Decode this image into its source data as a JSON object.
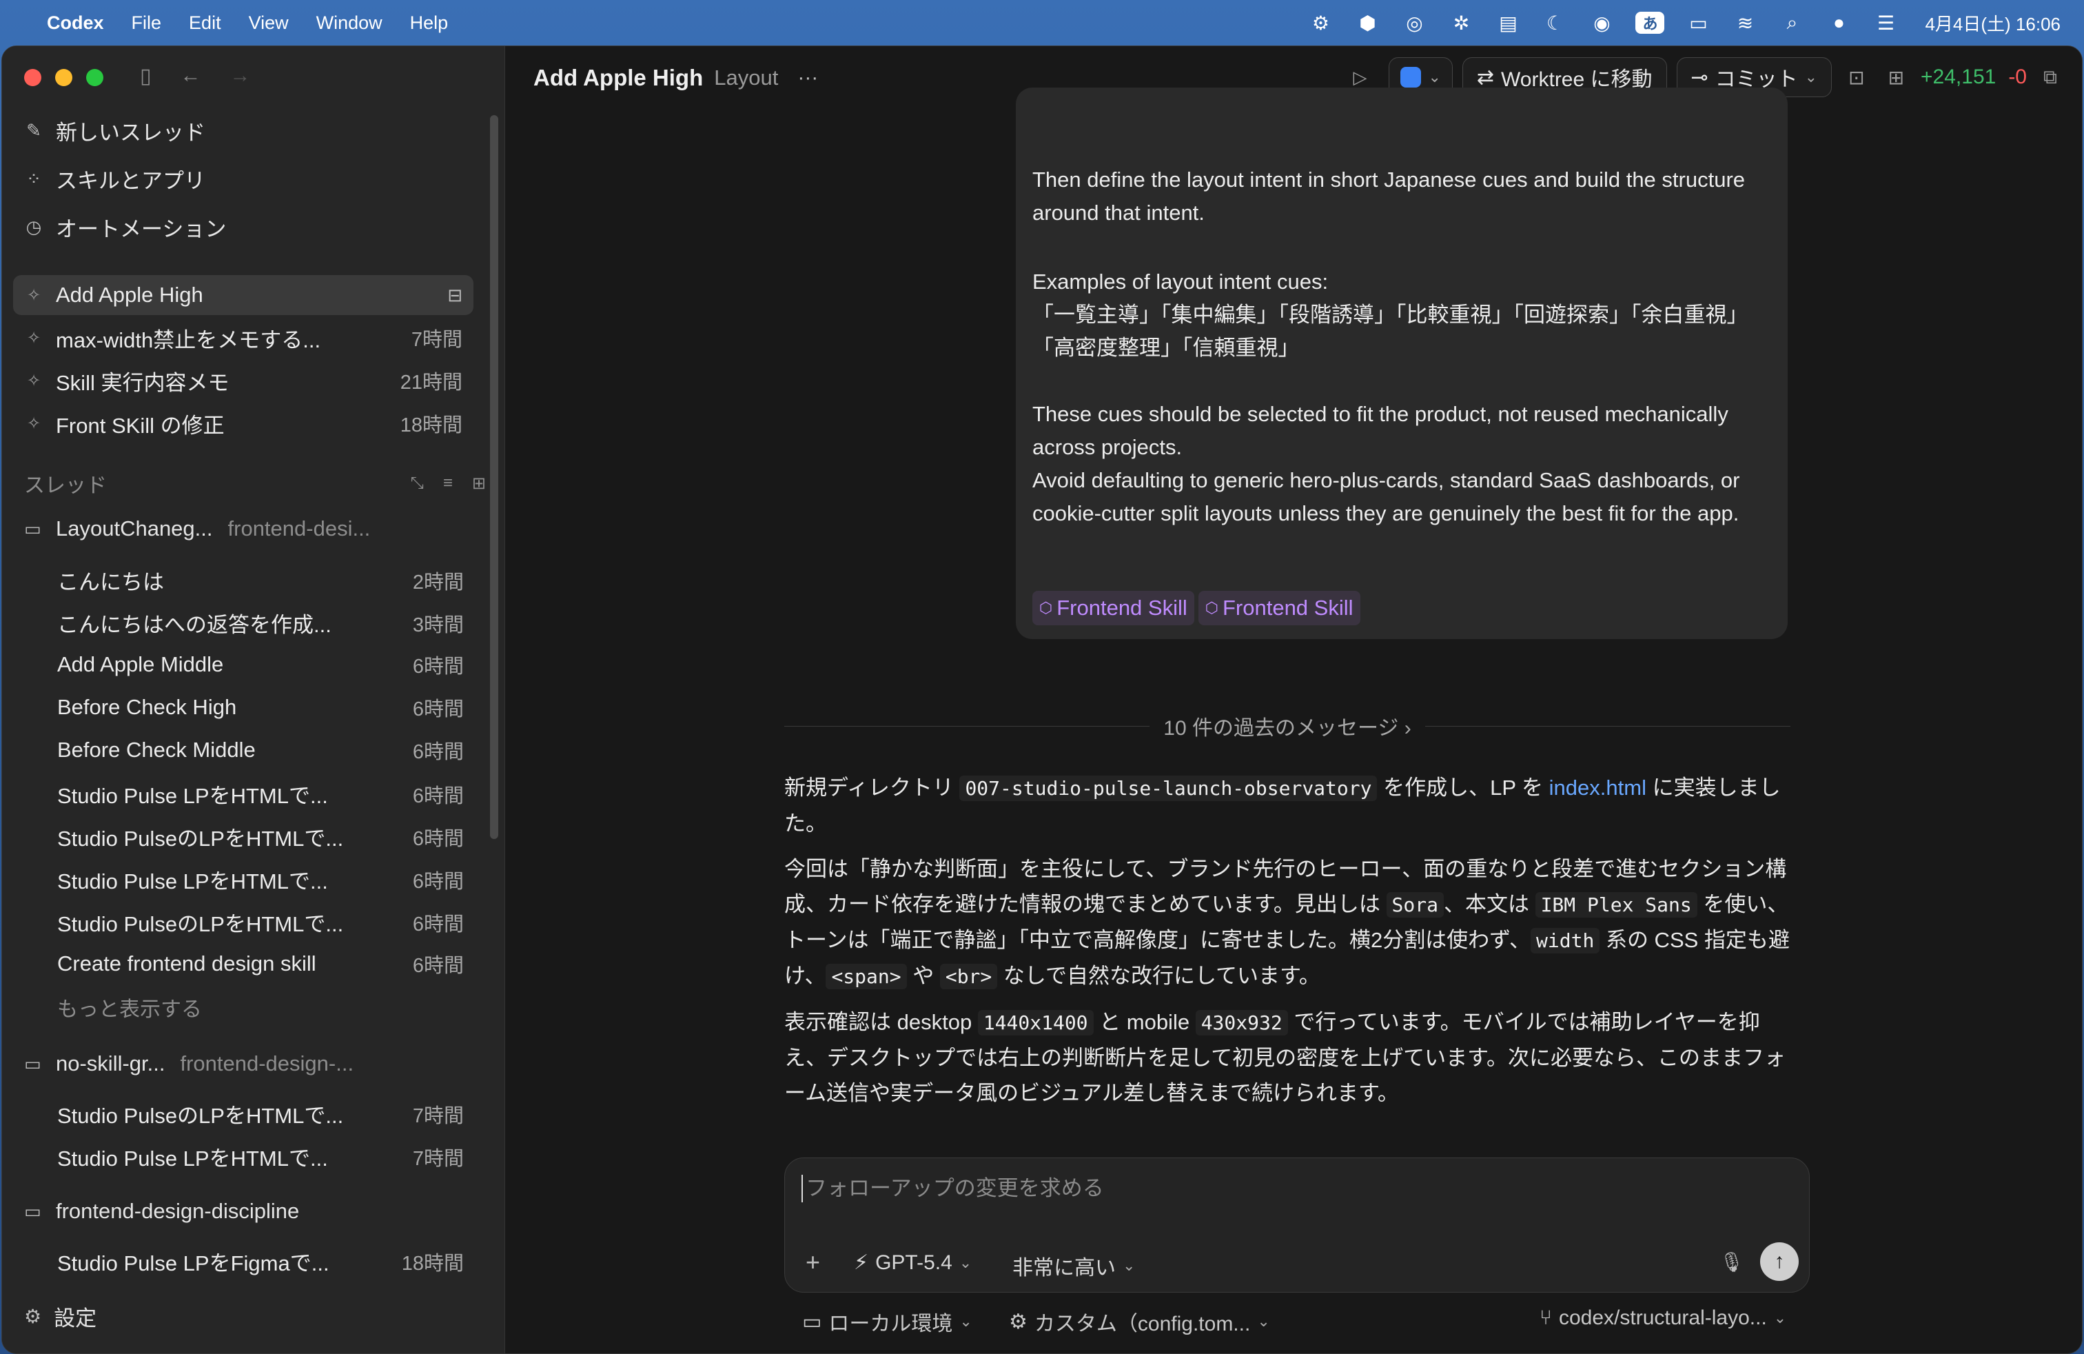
{
  "menubar": {
    "apple": "",
    "app_name": "Codex",
    "menus": [
      "File",
      "Edit",
      "View",
      "Window",
      "Help"
    ],
    "ime": "あ",
    "clock": "4月4日(土) 16:06"
  },
  "sidebar": {
    "nav": [
      {
        "label": "新しいスレッド",
        "icon": "edit-icon"
      },
      {
        "label": "スキルとアプリ",
        "icon": "grid-icon"
      },
      {
        "label": "オートメーション",
        "icon": "clock-icon"
      }
    ],
    "pinned": [
      {
        "label": "Add Apple High",
        "time": "",
        "active": true
      },
      {
        "label": "max-width禁止をメモする...",
        "time": "7時間"
      },
      {
        "label": "Skill 実行内容メモ",
        "time": "21時間"
      },
      {
        "label": "Front SKill の修正",
        "time": "18時間"
      }
    ],
    "threads_heading": "スレッド",
    "groups": [
      {
        "name": "LayoutChaneg...",
        "sub": "frontend-desi...",
        "items": [
          {
            "label": "こんにちは",
            "time": "2時間"
          },
          {
            "label": "こんにちはへの返答を作成...",
            "time": "3時間"
          },
          {
            "label": "Add Apple Middle",
            "time": "6時間"
          },
          {
            "label": "Before Check High",
            "time": "6時間"
          },
          {
            "label": "Before Check Middle",
            "time": "6時間"
          },
          {
            "label": "Studio Pulse LPをHTMLで...",
            "time": "6時間"
          },
          {
            "label": "Studio PulseのLPをHTMLで...",
            "time": "6時間"
          },
          {
            "label": "Studio Pulse LPをHTMLで...",
            "time": "6時間"
          },
          {
            "label": "Studio PulseのLPをHTMLで...",
            "time": "6時間"
          },
          {
            "label": "Create frontend design skill",
            "time": "6時間"
          }
        ],
        "more": "もっと表示する"
      },
      {
        "name": "no-skill-gr...",
        "sub": "frontend-design-...",
        "items": [
          {
            "label": "Studio PulseのLPをHTMLで...",
            "time": "7時間"
          },
          {
            "label": "Studio Pulse LPをHTMLで...",
            "time": "7時間"
          }
        ]
      },
      {
        "name": "frontend-design-discipline",
        "sub": "",
        "items": [
          {
            "label": "Studio Pulse LPをFigmaで...",
            "time": "18時間"
          }
        ]
      }
    ],
    "settings": "設定"
  },
  "topbar": {
    "title": "Add Apple High",
    "subtitle": "Layout",
    "worktree": "Worktree に移動",
    "commit": "コミット",
    "diff_add": "+24,151",
    "diff_del": "-0"
  },
  "user_message": {
    "para1": "Then define the layout intent in short Japanese cues and build the structure around that intent.",
    "para2_a": "Examples of layout intent cues:",
    "para2_b": "「一覧主導」「集中編集」「段階誘導」「比較重視」「回遊探索」「余白重視」",
    "para2_c": "「高密度整理」「信頼重視」",
    "para3": "These cues should be selected to fit the product, not reused mechanically across projects.",
    "para4": "Avoid defaulting to generic hero-plus-cards, standard SaaS dashboards, or cookie-cutter split layouts unless they are genuinely the best fit for the app.",
    "chips": [
      "Frontend Skill",
      "Frontend Skill"
    ]
  },
  "history_divider": "10 件の過去のメッセージ",
  "reply": {
    "p1_a": "新規ディレクトリ ",
    "p1_code": "007-studio-pulse-launch-observatory",
    "p1_b": " を作成し、LP を ",
    "p1_link": "index.html",
    "p1_c": " に実装しました。",
    "p2_a": "今回は「静かな判断面」を主役にして、ブランド先行のヒーロー、面の重なりと段差で進むセクション構成、カード依存を避けた情報の塊でまとめています。見出しは ",
    "p2_code1": "Sora",
    "p2_b": "、本文は ",
    "p2_code2": "IBM Plex Sans",
    "p2_c": " を使い、トーンは「端正で静謐」「中立で高解像度」に寄せました。横2分割は使わず、",
    "p2_code3": "width",
    "p2_d": " 系の CSS 指定も避け、",
    "p2_code4": "<span>",
    "p2_e": " や ",
    "p2_code5": "<br>",
    "p2_f": " なしで自然な改行にしています。",
    "p3_a": "表示確認は desktop ",
    "p3_code1": "1440x1400",
    "p3_b": " と mobile ",
    "p3_code2": "430x932",
    "p3_c": " で行っています。モバイルでは補助レイヤーを抑え、デスクトップでは右上の判断断片を足して初見の密度を上げています。次に必要なら、このままフォーム送信や実データ風のビジュアル差し替えまで続けられます。"
  },
  "composer": {
    "placeholder": "フォローアップの変更を求める",
    "model": "GPT-5.4",
    "effort": "非常に高い"
  },
  "bottombar": {
    "env": "ローカル環境",
    "config": "カスタム（config.tom...",
    "branch": "codex/structural-layo..."
  }
}
